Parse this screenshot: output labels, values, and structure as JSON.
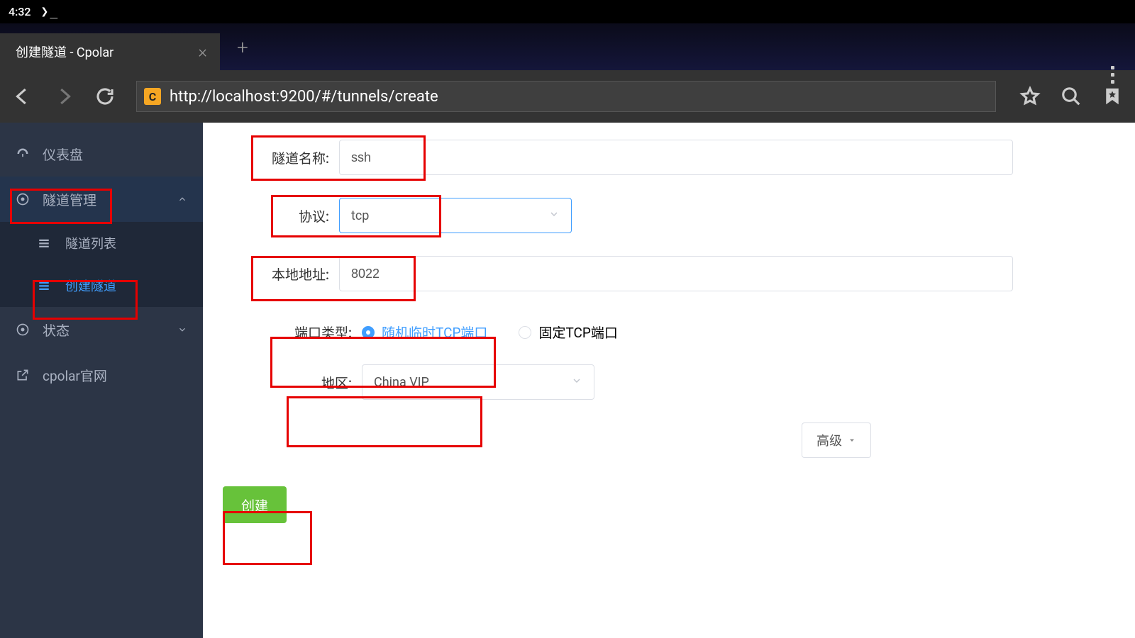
{
  "statusbar": {
    "time": "4:32",
    "prompt_glyph": "❯_"
  },
  "browser": {
    "tab_title": "创建隧道 - Cpolar",
    "url": "http://localhost:9200/#/tunnels/create",
    "favicon_letter": "C"
  },
  "sidebar": {
    "dashboard": "仪表盘",
    "tunnel_mgmt": "隧道管理",
    "tunnel_list": "隧道列表",
    "create_tunnel": "创建隧道",
    "status": "状态",
    "official_site": "cpolar官网"
  },
  "form": {
    "tunnel_name_label": "隧道名称:",
    "tunnel_name_value": "ssh",
    "protocol_label": "协议:",
    "protocol_value": "tcp",
    "local_addr_label": "本地地址:",
    "local_addr_value": "8022",
    "port_type_label": "端口类型:",
    "port_type_option1": "随机临时TCP端口",
    "port_type_option2": "固定TCP端口",
    "region_label": "地区:",
    "region_value": "China VIP",
    "advanced": "高级",
    "create": "创建"
  }
}
